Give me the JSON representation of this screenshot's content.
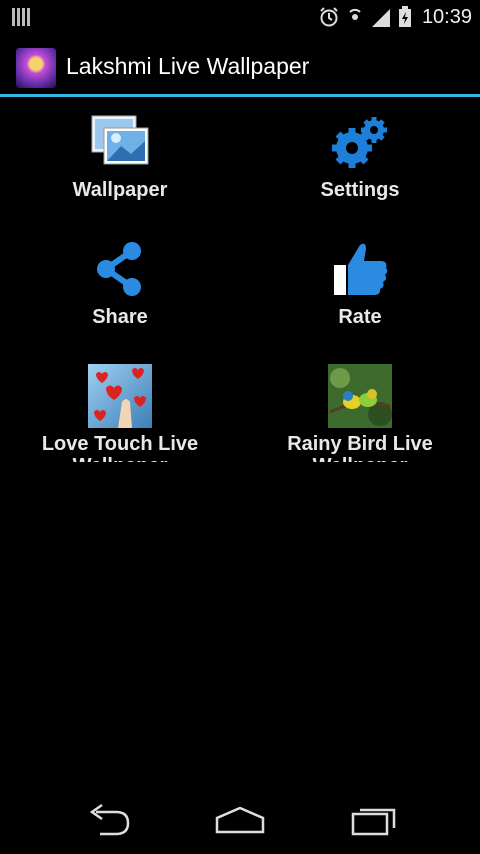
{
  "status_bar": {
    "time": "10:39",
    "icons": [
      "alarm-icon",
      "nfc-icon",
      "signal-icon",
      "battery-icon"
    ]
  },
  "action_bar": {
    "title": "Lakshmi Live Wallpaper"
  },
  "menu": [
    {
      "label": "Wallpaper",
      "icon": "wallpaper-icon"
    },
    {
      "label": "Settings",
      "icon": "settings-gears-icon"
    },
    {
      "label": "Share",
      "icon": "share-icon"
    },
    {
      "label": "Rate",
      "icon": "thumbs-up-icon"
    },
    {
      "label": "Love Touch Live",
      "label_cont": "Wallpaper",
      "icon": "love-touch-thumbnail"
    },
    {
      "label": "Rainy Bird Live",
      "label_cont": "Wallpaper",
      "icon": "rainy-bird-thumbnail"
    }
  ],
  "nav_bar": {
    "buttons": [
      "back-icon",
      "home-icon",
      "recent-apps-icon"
    ]
  },
  "colors": {
    "accent": "#33b5e5",
    "icon_blue": "#1e7fd8"
  }
}
